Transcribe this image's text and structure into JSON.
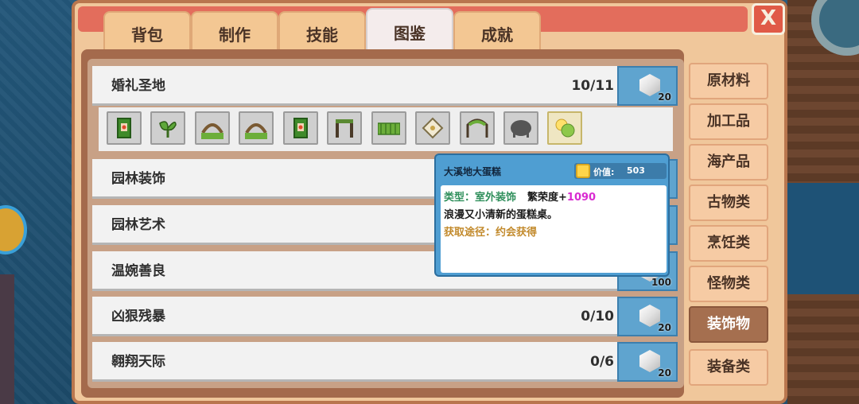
{
  "tabs": [
    {
      "label": "背包",
      "active": false
    },
    {
      "label": "制作",
      "active": false
    },
    {
      "label": "技能",
      "active": false
    },
    {
      "label": "图鉴",
      "active": true
    },
    {
      "label": "成就",
      "active": false
    }
  ],
  "close_label": "X",
  "collections": [
    {
      "name": "婚礼圣地",
      "count": "10/11",
      "reward_qty": "20"
    },
    {
      "name": "园林装饰",
      "count": "",
      "reward_qty": ""
    },
    {
      "name": "园林艺术",
      "count": "",
      "reward_qty": ""
    },
    {
      "name": "温婉善良",
      "count": "",
      "reward_qty": "100"
    },
    {
      "name": "凶狠残暴",
      "count": "0/10",
      "reward_qty": "20"
    },
    {
      "name": "翱翔天际",
      "count": "0/6",
      "reward_qty": "20"
    }
  ],
  "items": [
    {
      "icon": "green-card-icon",
      "color": "#6cae3a"
    },
    {
      "icon": "plant-icon",
      "color": "#4f8f2e"
    },
    {
      "icon": "grass-arch-icon",
      "color": "#8a6a3a"
    },
    {
      "icon": "grass-arch-icon",
      "color": "#8a6a3a"
    },
    {
      "icon": "green-card-icon",
      "color": "#6cae3a"
    },
    {
      "icon": "garden-gate-icon",
      "color": "#4a3a28"
    },
    {
      "icon": "fence-icon",
      "color": "#6cae3a"
    },
    {
      "icon": "lamp-icon",
      "color": "#c9b98a"
    },
    {
      "icon": "vine-arch-icon",
      "color": "#5c8f3a"
    },
    {
      "icon": "locked-silhouette-icon",
      "color": "#555555"
    },
    {
      "icon": "cake-icon",
      "color": "#b6d24e"
    }
  ],
  "categories": [
    {
      "label": "原材料",
      "active": false
    },
    {
      "label": "加工品",
      "active": false
    },
    {
      "label": "海产品",
      "active": false
    },
    {
      "label": "古物类",
      "active": false
    },
    {
      "label": "烹饪类",
      "active": false
    },
    {
      "label": "怪物类",
      "active": false
    },
    {
      "label": "装饰物",
      "active": true
    },
    {
      "label": "装备类",
      "active": false
    }
  ],
  "tooltip": {
    "title": "大溪地大蛋糕",
    "value_label": "价值:",
    "value": "503",
    "type_text": "类型：室外装饰",
    "prosperity_label": "繁荣度+",
    "prosperity_value": "1090",
    "description": "浪漫又小清新的蛋糕桌。",
    "source": "获取途径：约会获得"
  },
  "colors": {
    "frame": "#f0c79b",
    "active_category": "#a56f4f",
    "tooltip": "#4f9ed2",
    "prosperity": "#d92ad1"
  }
}
